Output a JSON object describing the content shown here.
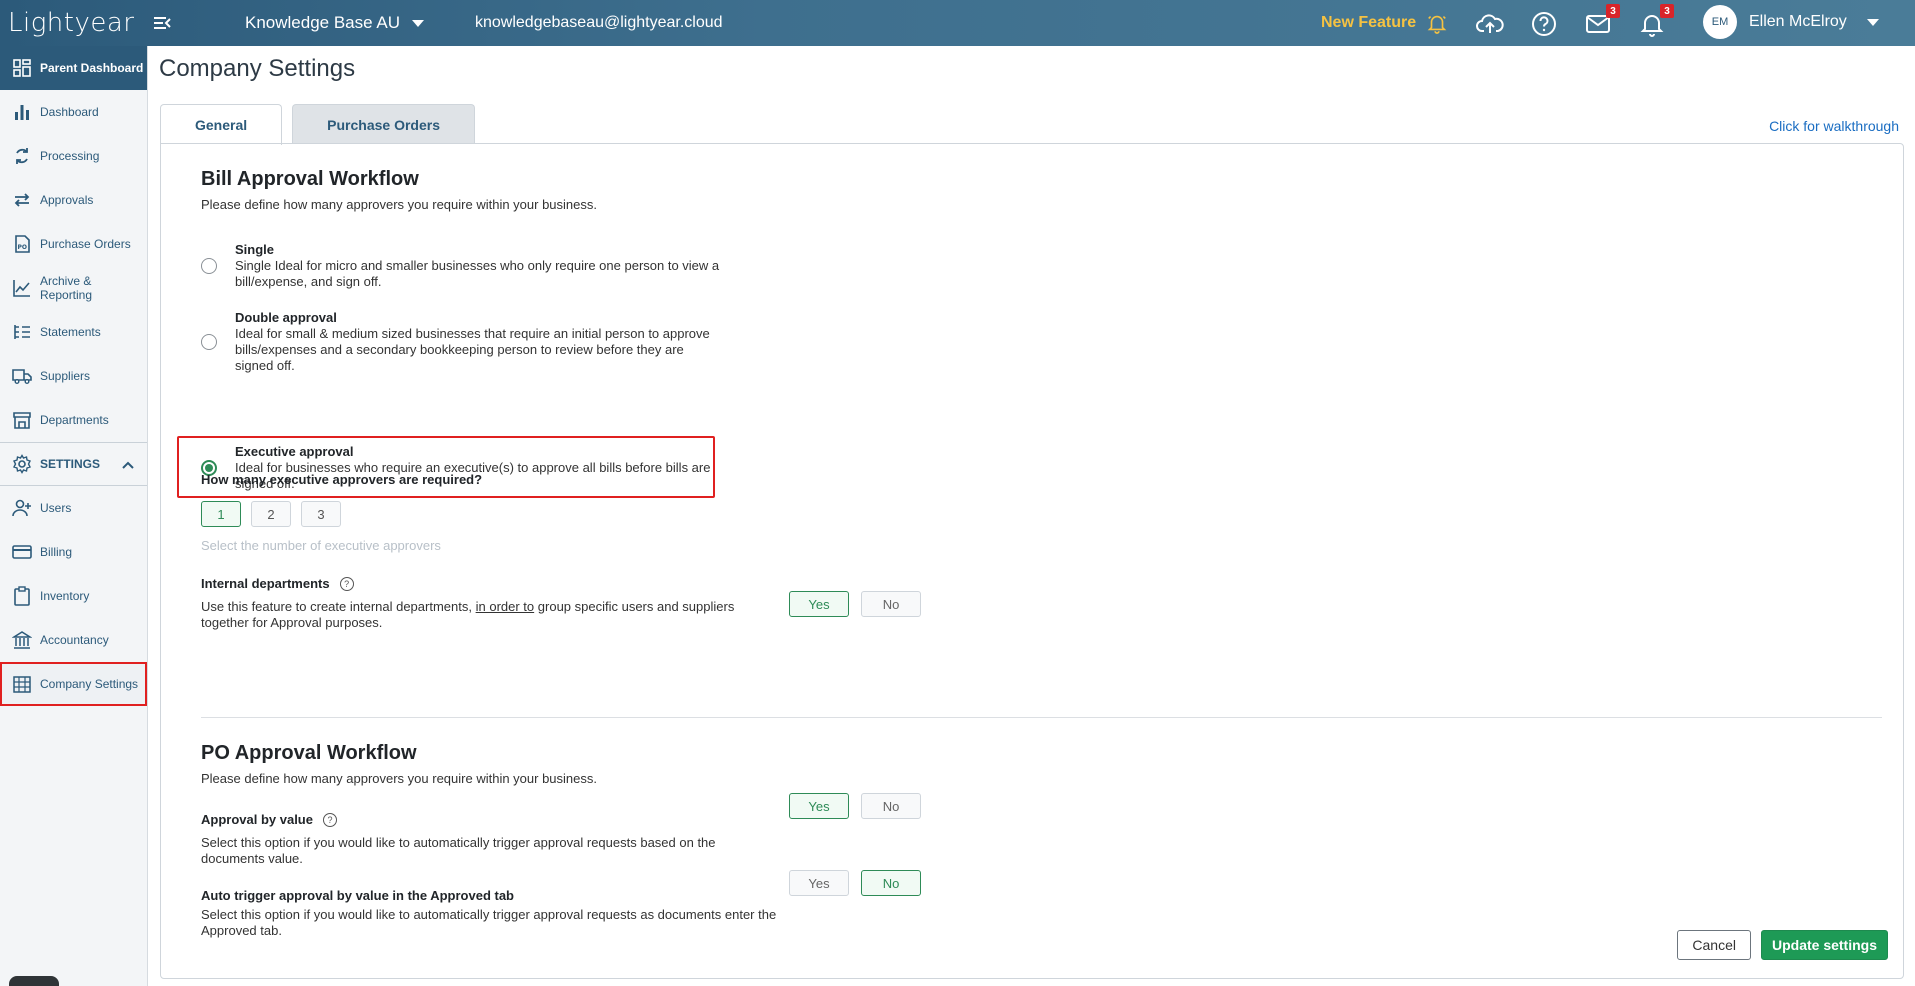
{
  "header": {
    "logo_text": "Lightyear",
    "org_name": "Knowledge Base AU",
    "email": "knowledgebaseau@lightyear.cloud",
    "new_feature_label": "New Feature",
    "mail_badge": "3",
    "notif_badge": "3",
    "avatar_initials": "EM",
    "user_name": "Ellen McElroy"
  },
  "sidebar": {
    "parent_dashboard": "Parent Dashboard",
    "items": [
      {
        "label": "Dashboard"
      },
      {
        "label": "Processing"
      },
      {
        "label": "Approvals"
      },
      {
        "label": "Purchase Orders"
      },
      {
        "label": "Archive & Reporting"
      },
      {
        "label": "Statements"
      },
      {
        "label": "Suppliers"
      },
      {
        "label": "Departments"
      }
    ],
    "settings_label": "SETTINGS",
    "settings_items": [
      {
        "label": "Users"
      },
      {
        "label": "Billing"
      },
      {
        "label": "Inventory"
      },
      {
        "label": "Accountancy"
      },
      {
        "label": "Company Settings"
      }
    ],
    "help_label": "?"
  },
  "page": {
    "title": "Company Settings",
    "tabs": [
      {
        "label": "General",
        "active": true
      },
      {
        "label": "Purchase Orders",
        "active": false
      }
    ],
    "walkthrough": "Click for walkthrough"
  },
  "bill_approval": {
    "title": "Bill Approval Workflow",
    "subtitle": "Please define how many approvers you require within your business.",
    "options": [
      {
        "title": "Single",
        "desc": "Single Ideal for micro and smaller businesses who only require one person to view a bill/expense, and sign off.",
        "checked": false
      },
      {
        "title": "Double approval",
        "desc": "Ideal for small & medium sized businesses that require an initial person to approve bills/expenses and a secondary bookkeeping person to review before they are signed off.",
        "checked": false
      },
      {
        "title": "Executive approval",
        "desc": "Ideal for businesses who require an executive(s) to approve all bills before bills are signed off.",
        "checked": true
      }
    ],
    "exec_question": "How many executive approvers are required?",
    "exec_counts": [
      "1",
      "2",
      "3"
    ],
    "exec_selected": "1",
    "exec_hint": "Select the number of executive approvers",
    "internal_dept": {
      "label": "Internal departments",
      "desc_before": "Use this feature to create internal departments,",
      "desc_link": "in order to",
      "desc_after": "group specific users and suppliers together for Approval purposes.",
      "yes": "Yes",
      "no": "No",
      "selected": "Yes"
    }
  },
  "po_approval": {
    "title": "PO Approval Workflow",
    "subtitle": "Please define how many approvers you require within your business.",
    "by_value": {
      "label": "Approval by value",
      "desc": "Select this option if you would like to automatically trigger approval requests based on the documents value.",
      "yes": "Yes",
      "no": "No",
      "selected": "Yes"
    },
    "auto_trigger": {
      "label": "Auto trigger approval by value in the Approved tab",
      "desc": "Select this option if you would like to automatically trigger approval requests as documents enter the Approved tab.",
      "yes": "Yes",
      "no": "No",
      "selected": "No"
    }
  },
  "footer": {
    "cancel": "Cancel",
    "update": "Update settings"
  },
  "colors": {
    "brand": "#2c5a7a",
    "accent_green": "#2e8b57",
    "highlight_red": "#e02020",
    "new_feature": "#f5c242"
  }
}
